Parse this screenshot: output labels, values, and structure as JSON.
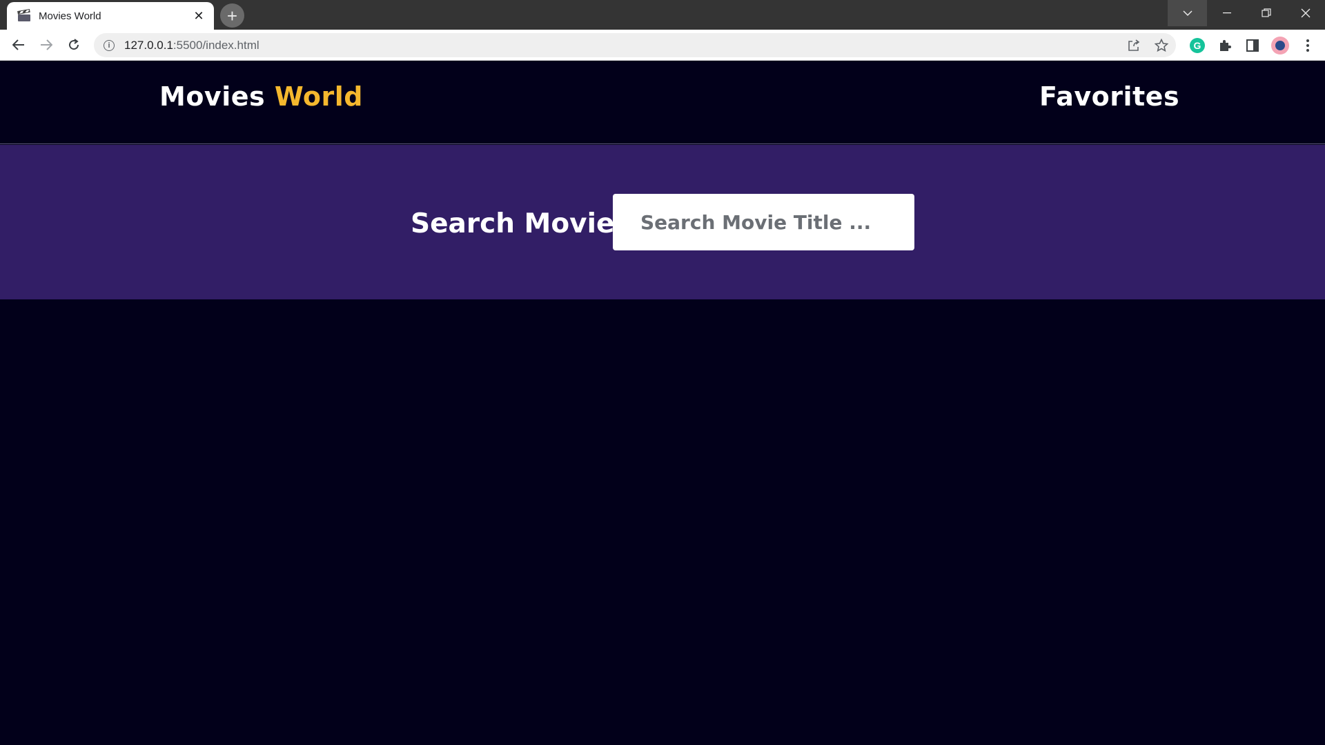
{
  "browser": {
    "tab_title": "Movies World",
    "tab_close": "✕",
    "new_tab": "+",
    "url_host": "127.0.0.1",
    "url_path": ":5500/index.html"
  },
  "site": {
    "logo_main": "Movies ",
    "logo_accent": "World",
    "nav_favorites": "Favorites",
    "accent_color": "#f5b82e",
    "header_bg": "#02001a",
    "search_band_bg": "#321e66"
  },
  "search": {
    "label": "Search Movie:",
    "placeholder": "Search Movie Title ...",
    "value": ""
  }
}
